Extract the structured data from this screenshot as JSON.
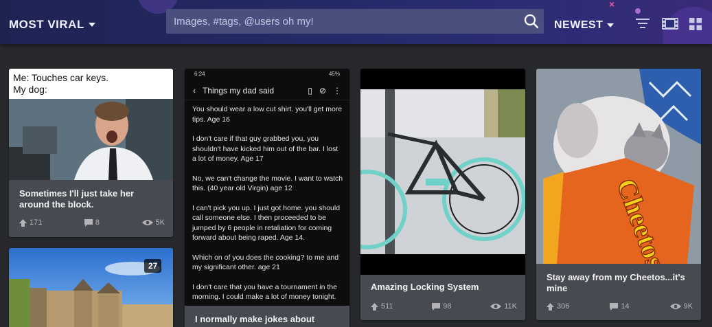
{
  "header": {
    "section_label": "MOST VIRAL",
    "search_placeholder": "Images, #tags, @users oh my!",
    "sort_label": "NEWEST"
  },
  "cards": [
    {
      "meme_text": [
        "Me: Touches car keys.",
        "My dog:"
      ],
      "title": "Sometimes I'll just take her around the block.",
      "upvotes": "171",
      "comments": "8",
      "views": "5K"
    },
    {
      "phone": {
        "time": "6:24",
        "battery": "45%",
        "title": "Things my dad said",
        "paragraphs": [
          "You should wear a low cut shirt. you'll get more tips. Age 16",
          "I don't care if that guy grabbed you, you shouldn't have kicked him out of the bar. I lost a lot of money. Age 17",
          "No, we can't change the movie. I want to watch this. (40 year old Virgin) age 12",
          "I can't pick you up. I just got home. you should call someone else. I then proceeded to be jumped by 6 people in retaliation for coming forward about being raped. Age 14.",
          "Which on of you does the cooking? to me and my significant other. age 21",
          "I don't care that you have a tournament in the morning. I could make a lot of money tonight."
        ]
      },
      "title": "I normally make jokes about"
    },
    {
      "title": "Amazing Locking System",
      "upvotes": "511",
      "comments": "98",
      "views": "11K"
    },
    {
      "title": "Stay away from my Cheetos...it's mine",
      "upvotes": "306",
      "comments": "14",
      "views": "9K",
      "bag_text": "Cheetos"
    },
    {
      "badge": "27"
    }
  ],
  "colors": {
    "header_bg": "#232a66",
    "page_bg": "#27292d",
    "card_bg": "#474a51"
  }
}
